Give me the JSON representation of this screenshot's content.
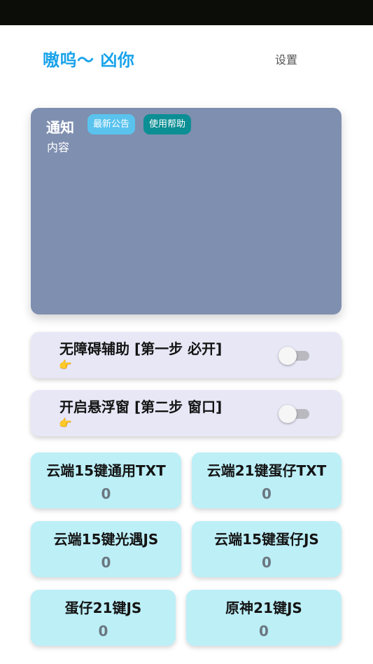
{
  "header": {
    "title": "嗷呜～ 凶你",
    "settings_label": "设置"
  },
  "notice": {
    "title": "通知",
    "content": "内容",
    "latest_label": "最新公告",
    "help_label": "使用帮助"
  },
  "switches": [
    {
      "label": "无障碍辅助 [第一步 必开]",
      "hint_icon": "pointing-hand-icon",
      "hint_text": "👉",
      "enabled": false
    },
    {
      "label": "开启悬浮窗 [第二步 窗口]",
      "hint_icon": "pointing-hand-icon",
      "hint_text": "👉",
      "enabled": false
    }
  ],
  "keys": [
    {
      "name": "云端15键通用TXT",
      "count": "0"
    },
    {
      "name": "云端21键蛋仔TXT",
      "count": "0"
    },
    {
      "name": "云端15键光遇JS",
      "count": "0"
    },
    {
      "name": "云端15键蛋仔JS",
      "count": "0"
    },
    {
      "name": "蛋仔21键JS",
      "count": "0"
    },
    {
      "name": "原神21键JS",
      "count": "0"
    }
  ],
  "colors": {
    "title": "#1aa3ea",
    "notice_bg": "#7f8fb0",
    "badge_latest": "#59c3ee",
    "badge_help": "#0b8f94",
    "switch_bg": "#e7e7f6",
    "key_bg": "#bdeff7"
  }
}
